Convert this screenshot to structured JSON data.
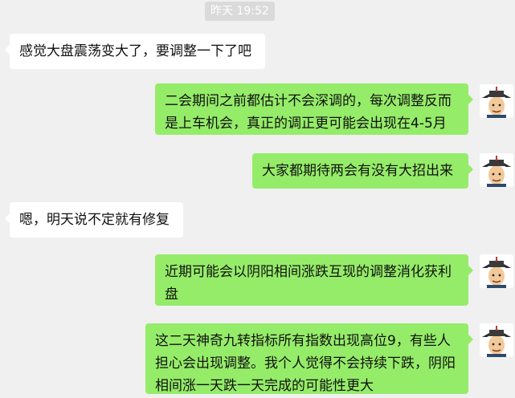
{
  "timestamp": "昨天 19:52",
  "messages": [
    {
      "id": "m1",
      "side": "left",
      "text": "感觉大盘震荡变大了，要调整一下了吧"
    },
    {
      "id": "m2",
      "side": "right",
      "text": "二会期间之前都估计不会深调的，每次调整反而是上车机会，真正的调正更可能会出现在4-5月"
    },
    {
      "id": "m3",
      "side": "right",
      "text": "大家都期待两会有没有大招出来"
    },
    {
      "id": "m4",
      "side": "left",
      "text": "嗯，明天说不定就有修复"
    },
    {
      "id": "m5",
      "side": "right",
      "text": "近期可能会以阴阳相间涨跌互现的调整消化获利盘"
    },
    {
      "id": "m6",
      "side": "right",
      "text": "这二天神奇九转指标所有指数出现高位9，有些人担心会出现调整。我个人觉得不会持续下跌，阴阳相间涨一天跌一天完成的可能性更大"
    }
  ],
  "colors": {
    "background": "#f0f0f0",
    "incoming_bubble": "#ffffff",
    "outgoing_bubble": "#95ec69",
    "timestamp_bg": "#dadada"
  },
  "icons": {
    "avatar": "sender-avatar-icon"
  }
}
